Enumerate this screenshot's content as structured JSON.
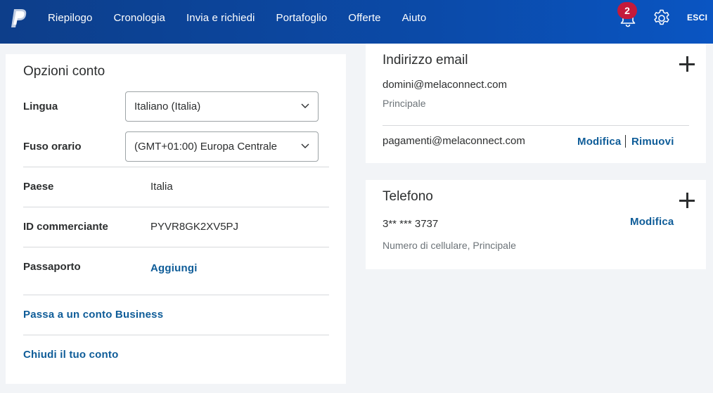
{
  "header": {
    "nav": [
      "Riepilogo",
      "Cronologia",
      "Invia e richiedi",
      "Portafoglio",
      "Offerte",
      "Aiuto"
    ],
    "notifications_count": "2",
    "logout_label": "ESCI",
    "colors": {
      "bar": "#0b4aa8",
      "badge": "#c41a3b"
    }
  },
  "account_options": {
    "title": "Opzioni conto",
    "language": {
      "label": "Lingua",
      "value": "Italiano (Italia)"
    },
    "timezone": {
      "label": "Fuso orario",
      "value": "(GMT+01:00) Europa Centrale"
    },
    "country": {
      "label": "Paese",
      "value": "Italia"
    },
    "merchant_id": {
      "label": "ID commerciante",
      "value": "PYVR8GK2XV5PJ"
    },
    "passport": {
      "label": "Passaporto",
      "action": "Aggiungi"
    },
    "business_link": "Passa a un conto Business",
    "close_link": "Chiudi il tuo conto"
  },
  "email": {
    "title": "Indirizzo email",
    "primary": {
      "address": "domini@melaconnect.com",
      "tag": "Principale"
    },
    "secondary": {
      "address": "pagamenti@melaconnect.com",
      "edit": "Modifica",
      "remove": "Rimuovi"
    }
  },
  "phone": {
    "title": "Telefono",
    "number": "3** *** 3737",
    "description": "Numero di cellulare, Principale",
    "edit": "Modifica"
  },
  "link_color": "#0e5c98"
}
